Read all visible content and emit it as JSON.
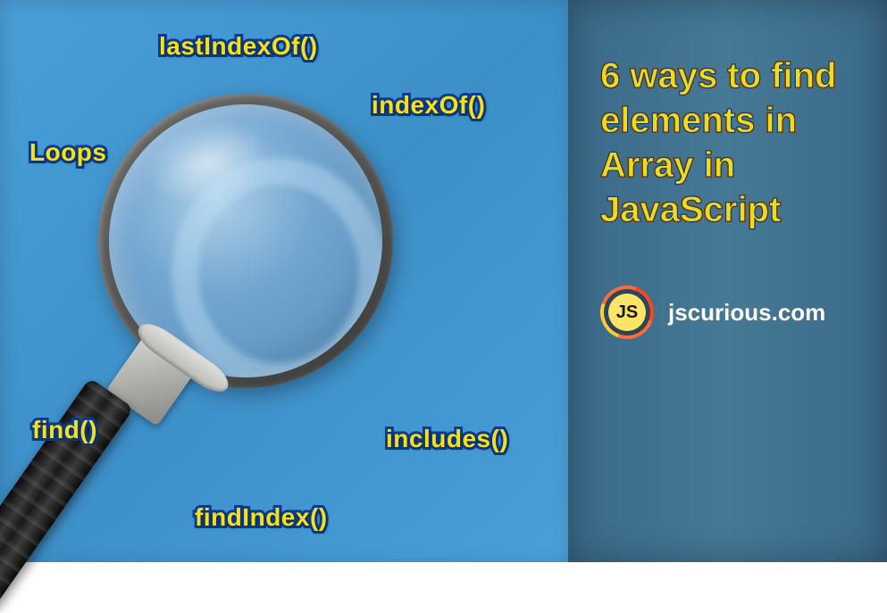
{
  "methods": {
    "lastIndexOf": "lastIndexOf()",
    "indexOf": "indexOf()",
    "loops": "Loops",
    "find": "find()",
    "includes": "includes()",
    "findIndex": "findIndex()"
  },
  "title": "6 ways to find elements in Array in JavaScript",
  "logo": {
    "text": "JS",
    "siteName": "jscurious.com"
  }
}
